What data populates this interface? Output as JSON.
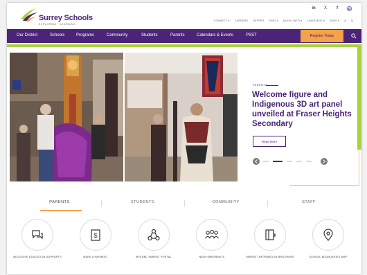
{
  "brand": {
    "name": "Surrey Schools",
    "tagline": "EXPLORING · LEARNING",
    "purple": "#4b2478",
    "green": "#a9d23f",
    "orange": "#f5a24a"
  },
  "social": [
    "in",
    "X",
    "f",
    "ig"
  ],
  "utility_links": [
    "CONNECT ▾",
    "CAREERS",
    "OFFERS",
    "FIND A",
    "QUICK INFO ▾",
    "LANGUAGE ▾",
    "JOBS ▾",
    "A",
    "Q"
  ],
  "nav": {
    "items": [
      "Our District",
      "Schools",
      "Programs",
      "Community",
      "Students",
      "Parents",
      "Calendars & Events",
      "PSST"
    ],
    "register_label": "Register Today"
  },
  "hero": {
    "eyebrow": "PARENTS",
    "headline": "Welcome figure and Indigenous 3D art panel unveiled at Fraser Heights Secondary",
    "read_more_label": "Read More",
    "slide_active": 1,
    "slide_count": 5
  },
  "tabs": {
    "items": [
      "PARENTS",
      "STUDENTS",
      "COMMUNITY",
      "STAFF"
    ],
    "active": 0
  },
  "quick_links": [
    {
      "label": "INCLUSIVE EDUCATION SUPPORTS",
      "icon": "chat-bubbles-icon"
    },
    {
      "label": "MAKE A PAYMENT",
      "icon": "dollar-document-icon"
    },
    {
      "label": "MYEDBC PARENT PORTAL",
      "icon": "people-network-icon"
    },
    {
      "label": "NEW IMMIGRANTS",
      "icon": "group-icon"
    },
    {
      "label": "PARENT INFORMATION BROCHURE",
      "icon": "brochure-icon"
    },
    {
      "label": "SCHOOL BOUNDARIES MAP",
      "icon": "map-pin-icon"
    }
  ]
}
